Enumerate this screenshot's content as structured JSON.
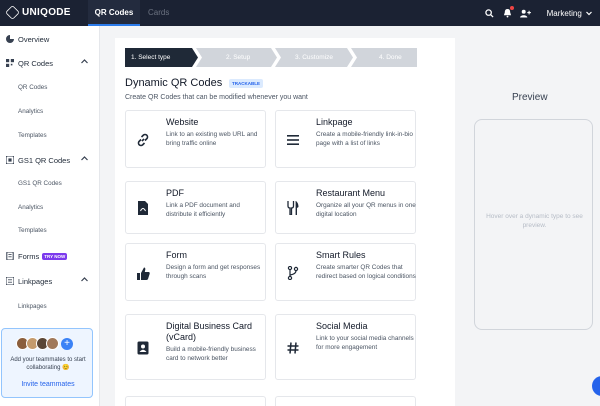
{
  "app": {
    "logo": "UNIQODE",
    "tabs": [
      {
        "label": "QR Codes",
        "active": true
      },
      {
        "label": "Cards",
        "active": false
      }
    ],
    "workspace": "Marketing",
    "icons": [
      "search-icon",
      "bell-icon",
      "add-user-icon",
      "chevron-down-icon"
    ],
    "accent": "#2b7bea"
  },
  "sidebar": {
    "items": [
      {
        "label": "Overview",
        "icon": "pie-chart-icon"
      },
      {
        "label": "QR Codes",
        "icon": "qr-icon",
        "expanded": true
      },
      {
        "label": "GS1 QR Codes",
        "icon": "gs1-icon",
        "expanded": true
      },
      {
        "label": "Forms",
        "icon": "forms-icon",
        "badge": "TRY NOW"
      },
      {
        "label": "Linkpages",
        "icon": "linkpage-icon",
        "expanded": true
      }
    ],
    "subitems": {
      "qr": [
        "QR Codes",
        "Analytics",
        "Templates"
      ],
      "gs1": [
        "GS1 QR Codes",
        "Analytics",
        "Templates"
      ],
      "linkpages": [
        "Linkpages"
      ]
    },
    "invite": {
      "text": "Add your teammates to start collaborating 😊",
      "link": "Invite teammates"
    }
  },
  "main": {
    "steps": [
      "1. Select type",
      "2. Setup",
      "3. Customize",
      "4. Done"
    ],
    "title": "Dynamic QR Codes",
    "badge": "TRACKABLE",
    "subtitle": "Create QR Codes that can be modified whenever you want",
    "cards": [
      {
        "title": "Website",
        "desc": "Link to an existing web URL and bring traffic online",
        "icon": "link-icon"
      },
      {
        "title": "Linkpage",
        "desc": "Create a mobile-friendly link-in-bio page with a list of links",
        "icon": "list-icon"
      },
      {
        "title": "PDF",
        "desc": "Link a PDF document and distribute it efficiently",
        "icon": "pdf-icon"
      },
      {
        "title": "Restaurant Menu",
        "desc": "Organize all your QR menus in one digital location",
        "icon": "fork-knife-icon"
      },
      {
        "title": "Form",
        "desc": "Design a form and get responses through scans",
        "icon": "thumbs-up-icon"
      },
      {
        "title": "Smart Rules",
        "desc": "Create smarter QR Codes that redirect based on logical conditions",
        "icon": "branch-icon"
      },
      {
        "title": "Digital Business Card (vCard)",
        "desc": "Build a mobile-friendly business card to network better",
        "icon": "contact-card-icon"
      },
      {
        "title": "Social Media",
        "desc": "Link to your social media channels for more engagement",
        "icon": "hashtag-icon"
      }
    ]
  },
  "preview": {
    "title": "Preview",
    "hint": "Hover over a dynamic type to see preview."
  }
}
